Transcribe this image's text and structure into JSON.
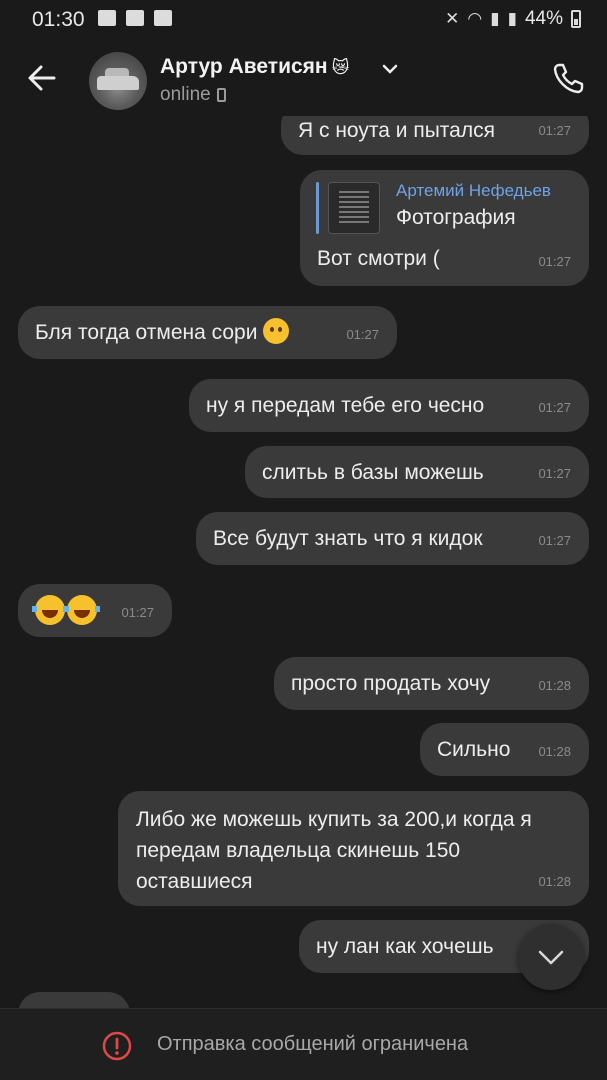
{
  "status_bar": {
    "time": "01:30",
    "battery": "44%"
  },
  "header": {
    "name": "Артур Аветисян",
    "name_emoji": "😿",
    "status": "online",
    "icons": [
      "arrow-left-icon",
      "chevron-down-icon",
      "phone-icon"
    ]
  },
  "messages": [
    {
      "side": "out",
      "text": "Я с ноута и пытался",
      "time": "01:27"
    },
    {
      "side": "out",
      "reply_author": "Артемий Нефедьев",
      "reply_text": "Фотография",
      "text": "Вот смотри (",
      "time": "01:27"
    },
    {
      "side": "in",
      "text": "Бля тогда отмена сори",
      "time": "01:27"
    },
    {
      "side": "out",
      "text": "ну я передам тебе его чесно",
      "time": "01:27"
    },
    {
      "side": "out",
      "text": "слитьь в базы можешь",
      "time": "01:27"
    },
    {
      "side": "out",
      "text": "Все будут знать что я кидок",
      "time": "01:27"
    },
    {
      "side": "in",
      "text": "",
      "time": "01:27"
    },
    {
      "side": "out",
      "text": "просто продать хочу",
      "time": "01:28"
    },
    {
      "side": "out",
      "text": "Сильно",
      "time": "01:28"
    },
    {
      "side": "out",
      "text": "Либо же можешь купить за 200,и когда я передам владельца скинешь 150 оставшиеся",
      "time": "01:28"
    },
    {
      "side": "out",
      "text": "ну лан как хочешь",
      "time": ""
    }
  ],
  "footer": {
    "text": "Отправка сообщений ограничена"
  },
  "colors": {
    "background": "#1a1a1a",
    "bubble": "#3a3a3a",
    "accent": "#6ea3e6",
    "alert": "#e04848"
  }
}
